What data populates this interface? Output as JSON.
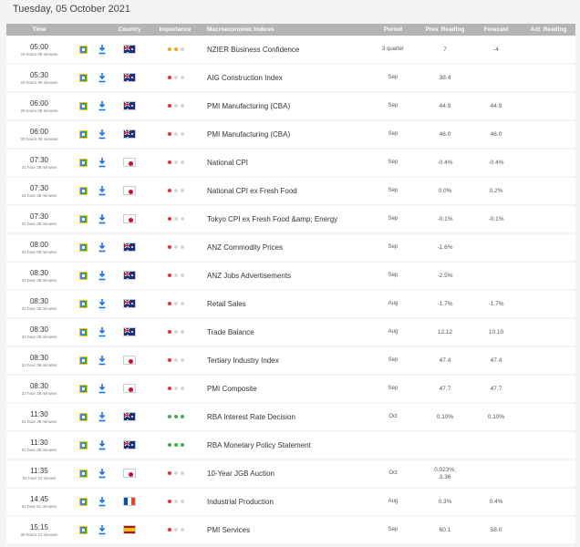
{
  "date_title": "Tuesday, 05 October 2021",
  "columns": {
    "time": "Time",
    "country": "Country",
    "importance": "Importance",
    "indices": "Macroeconomic Indices",
    "period": "Period",
    "prev": "Prev. Reading",
    "forecast": "Forecast",
    "actual": "Act. Reading"
  },
  "colors": {
    "header_bg": "#b4b4b4",
    "importance_high": "#3fae49",
    "importance_medium": "#f2a51a",
    "importance_low": "#e8312f",
    "download_icon": "#1a73e8"
  },
  "events": [
    {
      "time": "05:00",
      "ago": "19 hours 08 minutes",
      "country": "au",
      "importance": "medium",
      "name": "NZIER Business Confidence",
      "period": "3 quarter",
      "prev": "7",
      "forecast": "-4",
      "actual": ""
    },
    {
      "time": "05:30",
      "ago": "19 hours 38 minutes",
      "country": "au",
      "importance": "low",
      "name": "AIG Construction Index",
      "period": "Sep",
      "prev": "38.4",
      "forecast": "",
      "actual": ""
    },
    {
      "time": "06:00",
      "ago": "20 hours 08 minutes",
      "country": "au",
      "importance": "low",
      "name": "PMI Manufacturing (CBA)",
      "period": "Sep",
      "prev": "44.9",
      "forecast": "44.9",
      "actual": ""
    },
    {
      "time": "06:00",
      "ago": "20 hours 08 minutes",
      "country": "au",
      "importance": "low",
      "name": "PMI Manufacturing (CBA)",
      "period": "Sep",
      "prev": "46.0",
      "forecast": "46.0",
      "actual": ""
    },
    {
      "time": "07:30",
      "ago": "21 hour 38 minutes",
      "country": "jp",
      "importance": "low",
      "name": "National CPI",
      "period": "Sep",
      "prev": "-0.4%",
      "forecast": "-0.4%",
      "actual": ""
    },
    {
      "time": "07:30",
      "ago": "21 hour 38 minutes",
      "country": "jp",
      "importance": "low",
      "name": "National CPI ex Fresh Food",
      "period": "Sep",
      "prev": "0.0%",
      "forecast": "0.2%",
      "actual": ""
    },
    {
      "time": "07:30",
      "ago": "21 hour 38 minutes",
      "country": "jp",
      "importance": "low",
      "name": "Tokyo CPI ex Fresh Food &amp; Energy",
      "period": "Sep",
      "prev": "-0.1%",
      "forecast": "-0.1%",
      "actual": ""
    },
    {
      "time": "08:00",
      "ago": "22 hour 08 minutes",
      "country": "au",
      "importance": "low",
      "name": "ANZ Commodity Prices",
      "period": "Sep",
      "prev": "-1.6%",
      "forecast": "",
      "actual": ""
    },
    {
      "time": "08:30",
      "ago": "22 hour 38 minutes",
      "country": "au",
      "importance": "low",
      "name": "ANZ Jobs Advertisements",
      "period": "Sep",
      "prev": "-2.5%",
      "forecast": "",
      "actual": ""
    },
    {
      "time": "08:30",
      "ago": "22 hour 38 minutes",
      "country": "au",
      "importance": "low",
      "name": "Retail Sales",
      "period": "Aug",
      "prev": "-1.7%",
      "forecast": "-1.7%",
      "actual": ""
    },
    {
      "time": "08:30",
      "ago": "22 hour 38 minutes",
      "country": "au",
      "importance": "low",
      "name": "Trade Balance",
      "period": "Aug",
      "prev": "12.12",
      "forecast": "10.10",
      "actual": ""
    },
    {
      "time": "08:30",
      "ago": "22 hour 38 minutes",
      "country": "jp",
      "importance": "low",
      "name": "Tertiary Industry Index",
      "period": "Sep",
      "prev": "47.4",
      "forecast": "47.4",
      "actual": ""
    },
    {
      "time": "08:30",
      "ago": "22 hour 38 minutes",
      "country": "jp",
      "importance": "low",
      "name": "PMI Composite",
      "period": "Sep",
      "prev": "47.7",
      "forecast": "47.7",
      "actual": ""
    },
    {
      "time": "11:30",
      "ago": "01 hour 38 minutes",
      "country": "au",
      "importance": "high",
      "name": "RBA Interest Rate Decision",
      "period": "Oct",
      "prev": "0.10%",
      "forecast": "0.10%",
      "actual": ""
    },
    {
      "time": "11:30",
      "ago": "01 hour 38 minutes",
      "country": "au",
      "importance": "high",
      "name": "RBA Monetary Policy Statement",
      "period": "",
      "prev": "",
      "forecast": "",
      "actual": ""
    },
    {
      "time": "11:35",
      "ago": "01 hour 41 minute",
      "country": "jp",
      "importance": "low",
      "name": "10-Year JGB Auction",
      "period": "Oct",
      "prev": "0.023%;",
      "prev2": "3.36",
      "forecast": "",
      "actual": ""
    },
    {
      "time": "14:45",
      "ago": "04 hour 51 minutes",
      "country": "fr",
      "importance": "low",
      "name": "Industrial Production",
      "period": "Aug",
      "prev": "0.3%",
      "forecast": "0.4%",
      "actual": ""
    },
    {
      "time": "15:15",
      "ago": "05 hours 21 minutes",
      "country": "es",
      "importance": "low",
      "name": "PMI Services",
      "period": "Sep",
      "prev": "60.1",
      "forecast": "58.0",
      "actual": ""
    }
  ]
}
